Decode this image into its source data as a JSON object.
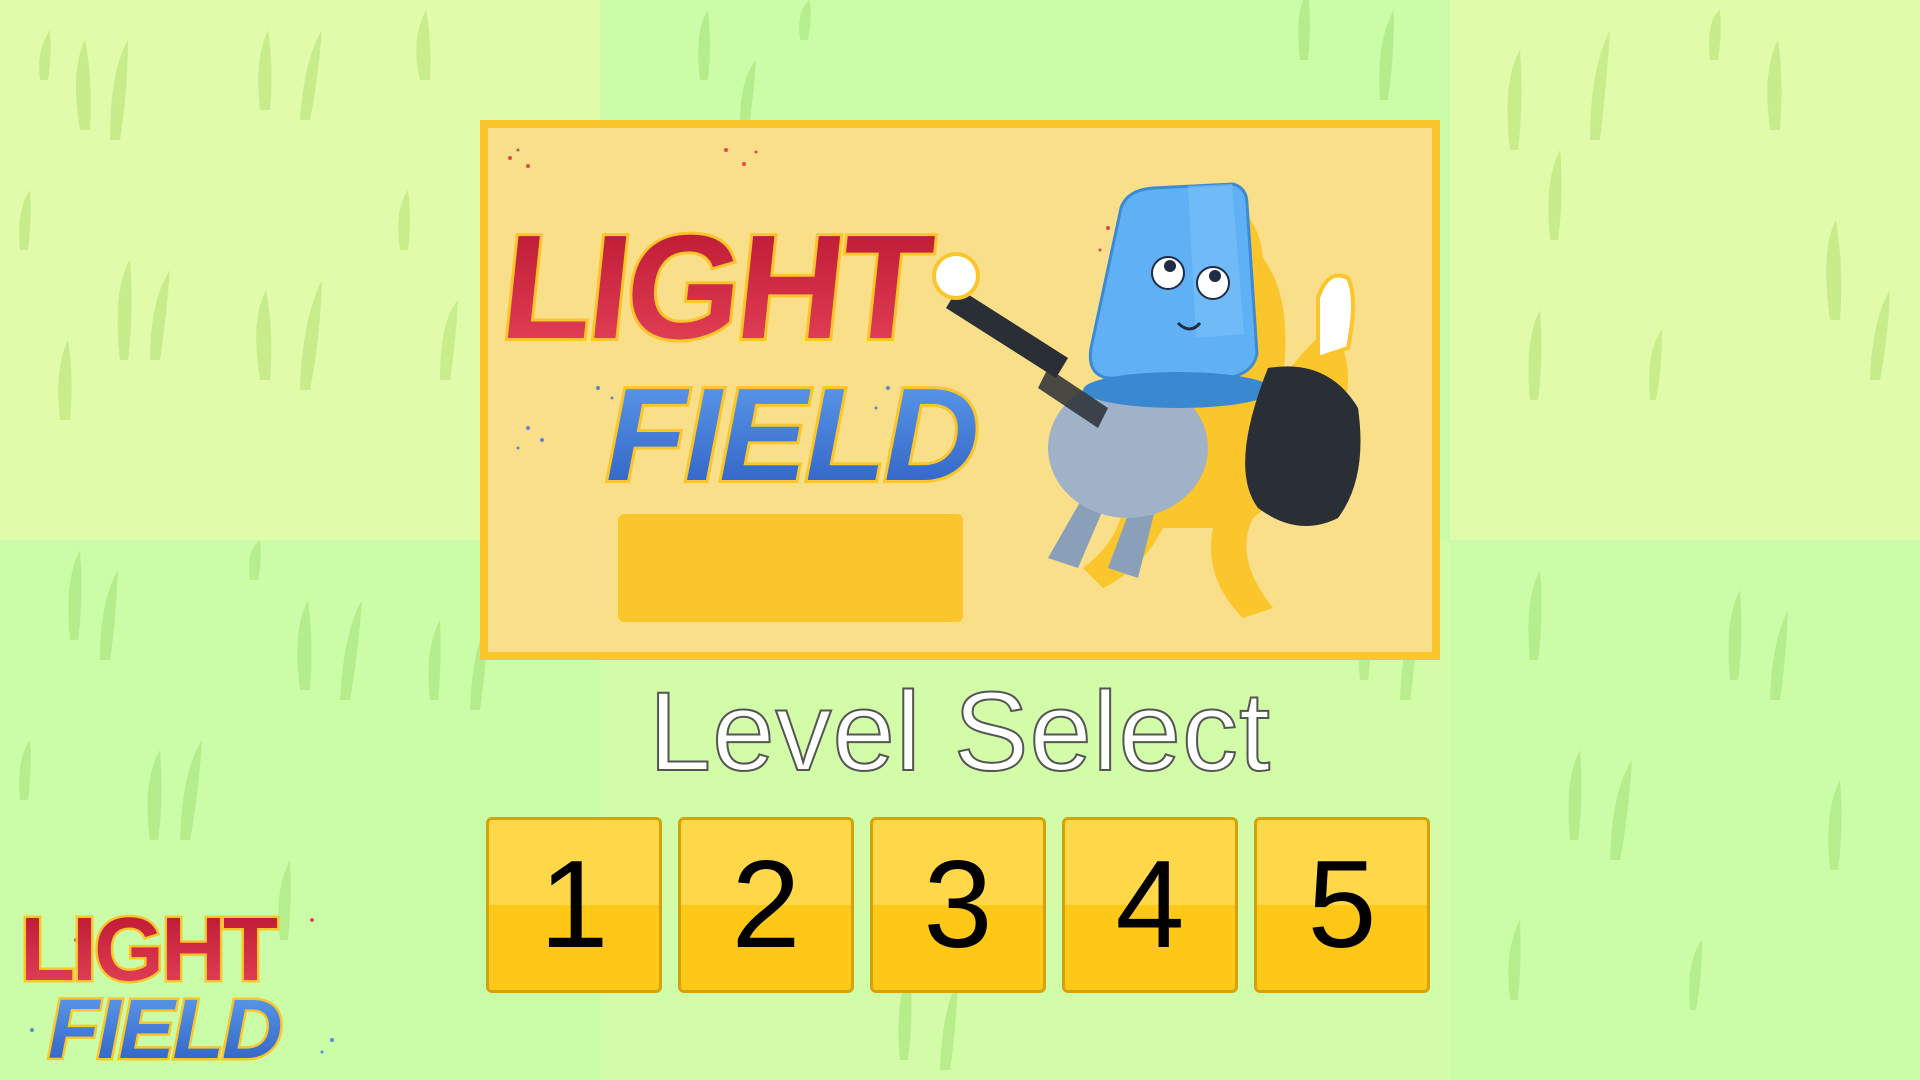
{
  "game": {
    "logo_line1": "LIGHT",
    "logo_line2": "FIELD",
    "screen_title": "Level Select"
  },
  "levels": [
    {
      "label": "1"
    },
    {
      "label": "2"
    },
    {
      "label": "3"
    },
    {
      "label": "4"
    },
    {
      "label": "5"
    }
  ],
  "colors": {
    "logo_top": "#d8243f",
    "logo_bottom": "#3a72d6",
    "banner_bg": "#fadf8a",
    "banner_border": "#fbc52c",
    "button_top": "#ffd84a",
    "button_bottom": "#ffc817",
    "grass_light": "#e0fbaa",
    "grass_green": "#cbfca8"
  },
  "icons": {
    "mascot": "flashlight-mascot-character"
  }
}
